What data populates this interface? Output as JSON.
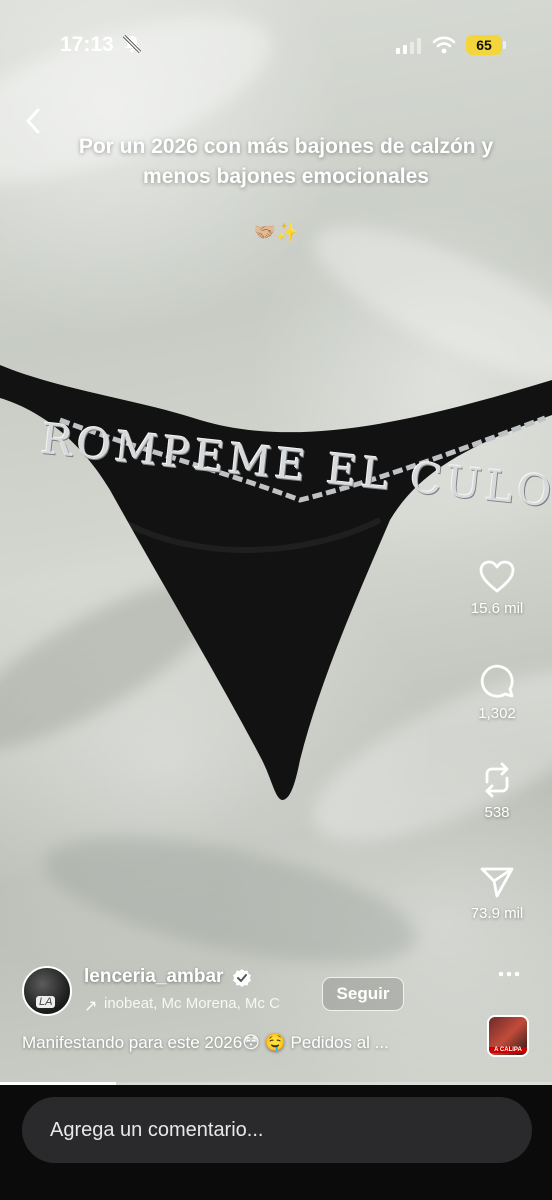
{
  "status_bar": {
    "time": "17:13",
    "battery": "65"
  },
  "caption": {
    "text": "Por un 2026 con más bajones de calzón y menos bajones emocionales",
    "emoji": "🤝🏼✨"
  },
  "photo_text": "ROMPEME EL CULO",
  "actions": [
    {
      "name": "like",
      "icon": "heart-icon",
      "count": "15.6 mil"
    },
    {
      "name": "comment",
      "icon": "comment-bubble-icon",
      "count": "1,302"
    },
    {
      "name": "repost",
      "icon": "repost-icon",
      "count": "538"
    },
    {
      "name": "share",
      "icon": "send-icon",
      "count": "73.9 mil"
    }
  ],
  "author": {
    "username": "lenceria_ambar",
    "avatar_text": "LA",
    "music": "inobeat, Mc Morena, Mc C",
    "follow_label": "Seguir"
  },
  "description": "Manifestando para este 2026😳 🤤 Pedidos al ...",
  "audio_thumb_text": "A CALIPA",
  "progress": 0.21,
  "comment_input": {
    "placeholder": "Agrega un comentario..."
  },
  "colors": {
    "battery": "#f2d63c",
    "comment_bg": "#2a2a2c"
  }
}
